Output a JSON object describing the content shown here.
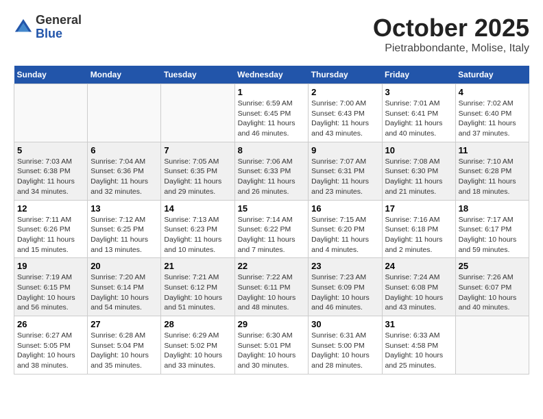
{
  "logo": {
    "general": "General",
    "blue": "Blue"
  },
  "header": {
    "month": "October 2025",
    "location": "Pietrabbondante, Molise, Italy"
  },
  "weekdays": [
    "Sunday",
    "Monday",
    "Tuesday",
    "Wednesday",
    "Thursday",
    "Friday",
    "Saturday"
  ],
  "weeks": [
    [
      {
        "day": "",
        "empty": true
      },
      {
        "day": "",
        "empty": true
      },
      {
        "day": "",
        "empty": true
      },
      {
        "day": "1",
        "sunrise": "6:59 AM",
        "sunset": "6:45 PM",
        "daylight": "11 hours and 46 minutes."
      },
      {
        "day": "2",
        "sunrise": "7:00 AM",
        "sunset": "6:43 PM",
        "daylight": "11 hours and 43 minutes."
      },
      {
        "day": "3",
        "sunrise": "7:01 AM",
        "sunset": "6:41 PM",
        "daylight": "11 hours and 40 minutes."
      },
      {
        "day": "4",
        "sunrise": "7:02 AM",
        "sunset": "6:40 PM",
        "daylight": "11 hours and 37 minutes."
      }
    ],
    [
      {
        "day": "5",
        "sunrise": "7:03 AM",
        "sunset": "6:38 PM",
        "daylight": "11 hours and 34 minutes."
      },
      {
        "day": "6",
        "sunrise": "7:04 AM",
        "sunset": "6:36 PM",
        "daylight": "11 hours and 32 minutes."
      },
      {
        "day": "7",
        "sunrise": "7:05 AM",
        "sunset": "6:35 PM",
        "daylight": "11 hours and 29 minutes."
      },
      {
        "day": "8",
        "sunrise": "7:06 AM",
        "sunset": "6:33 PM",
        "daylight": "11 hours and 26 minutes."
      },
      {
        "day": "9",
        "sunrise": "7:07 AM",
        "sunset": "6:31 PM",
        "daylight": "11 hours and 23 minutes."
      },
      {
        "day": "10",
        "sunrise": "7:08 AM",
        "sunset": "6:30 PM",
        "daylight": "11 hours and 21 minutes."
      },
      {
        "day": "11",
        "sunrise": "7:10 AM",
        "sunset": "6:28 PM",
        "daylight": "11 hours and 18 minutes."
      }
    ],
    [
      {
        "day": "12",
        "sunrise": "7:11 AM",
        "sunset": "6:26 PM",
        "daylight": "11 hours and 15 minutes."
      },
      {
        "day": "13",
        "sunrise": "7:12 AM",
        "sunset": "6:25 PM",
        "daylight": "11 hours and 13 minutes."
      },
      {
        "day": "14",
        "sunrise": "7:13 AM",
        "sunset": "6:23 PM",
        "daylight": "11 hours and 10 minutes."
      },
      {
        "day": "15",
        "sunrise": "7:14 AM",
        "sunset": "6:22 PM",
        "daylight": "11 hours and 7 minutes."
      },
      {
        "day": "16",
        "sunrise": "7:15 AM",
        "sunset": "6:20 PM",
        "daylight": "11 hours and 4 minutes."
      },
      {
        "day": "17",
        "sunrise": "7:16 AM",
        "sunset": "6:18 PM",
        "daylight": "11 hours and 2 minutes."
      },
      {
        "day": "18",
        "sunrise": "7:17 AM",
        "sunset": "6:17 PM",
        "daylight": "10 hours and 59 minutes."
      }
    ],
    [
      {
        "day": "19",
        "sunrise": "7:19 AM",
        "sunset": "6:15 PM",
        "daylight": "10 hours and 56 minutes."
      },
      {
        "day": "20",
        "sunrise": "7:20 AM",
        "sunset": "6:14 PM",
        "daylight": "10 hours and 54 minutes."
      },
      {
        "day": "21",
        "sunrise": "7:21 AM",
        "sunset": "6:12 PM",
        "daylight": "10 hours and 51 minutes."
      },
      {
        "day": "22",
        "sunrise": "7:22 AM",
        "sunset": "6:11 PM",
        "daylight": "10 hours and 48 minutes."
      },
      {
        "day": "23",
        "sunrise": "7:23 AM",
        "sunset": "6:09 PM",
        "daylight": "10 hours and 46 minutes."
      },
      {
        "day": "24",
        "sunrise": "7:24 AM",
        "sunset": "6:08 PM",
        "daylight": "10 hours and 43 minutes."
      },
      {
        "day": "25",
        "sunrise": "7:26 AM",
        "sunset": "6:07 PM",
        "daylight": "10 hours and 40 minutes."
      }
    ],
    [
      {
        "day": "26",
        "sunrise": "6:27 AM",
        "sunset": "5:05 PM",
        "daylight": "10 hours and 38 minutes."
      },
      {
        "day": "27",
        "sunrise": "6:28 AM",
        "sunset": "5:04 PM",
        "daylight": "10 hours and 35 minutes."
      },
      {
        "day": "28",
        "sunrise": "6:29 AM",
        "sunset": "5:02 PM",
        "daylight": "10 hours and 33 minutes."
      },
      {
        "day": "29",
        "sunrise": "6:30 AM",
        "sunset": "5:01 PM",
        "daylight": "10 hours and 30 minutes."
      },
      {
        "day": "30",
        "sunrise": "6:31 AM",
        "sunset": "5:00 PM",
        "daylight": "10 hours and 28 minutes."
      },
      {
        "day": "31",
        "sunrise": "6:33 AM",
        "sunset": "4:58 PM",
        "daylight": "10 hours and 25 minutes."
      },
      {
        "day": "",
        "empty": true
      }
    ]
  ],
  "labels": {
    "sunrise": "Sunrise:",
    "sunset": "Sunset:",
    "daylight": "Daylight:"
  }
}
